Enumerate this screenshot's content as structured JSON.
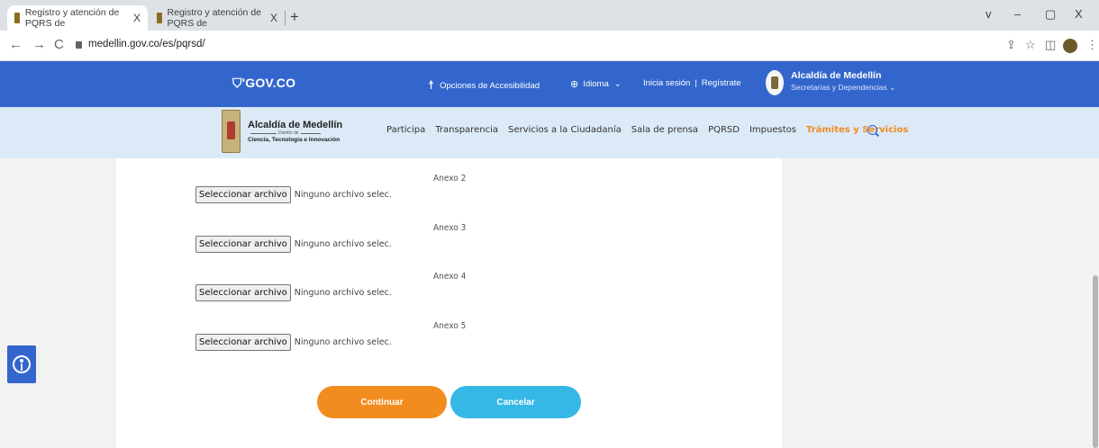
{
  "browser": {
    "tabs": [
      {
        "title": "Registro y atención de PQRS de",
        "close": "X"
      },
      {
        "title": "Registro y atención de PQRS de",
        "close": "X"
      }
    ],
    "new_tab": "+",
    "window_controls": [
      "v",
      "–",
      "▢",
      "X"
    ],
    "nav": {
      "back": "←",
      "forward": "→",
      "reload": "C"
    },
    "url": "medellin.gov.co/es/pqrsd/",
    "toolbar_icons": [
      "share-icon",
      "star-icon",
      "sidepanel-icon",
      "profile-avatar",
      "menu-icon"
    ],
    "toolbar_glyphs": {
      "share": "⇪",
      "star": "☆",
      "sidepanel": "◫",
      "menu": "⋮"
    }
  },
  "govbar": {
    "logo": "GOV.CO",
    "accessibility": "Opciones de Accesibilidad",
    "language": "Idioma",
    "login": "Inicia sesión",
    "separator": "|",
    "register": "Regístrate",
    "alcaldia_title": "Alcaldía de Medellín",
    "alcaldia_sub": "Secretarías y Dependencias"
  },
  "sitenav": {
    "brand_title": "Alcaldía de Medellín",
    "brand_district": "Distrito de",
    "brand_sub": "Ciencia, Tecnología e Innovación",
    "menu": [
      "Participa",
      "Transparencia",
      "Servicios a la Ciudadanía",
      "Sala de prensa",
      "PQRSD",
      "Impuestos",
      "Trámites y Servicios"
    ],
    "active_index": 6
  },
  "form": {
    "annexes": [
      {
        "label": "Anexo 2",
        "button": "Seleccionar archivo",
        "status": "Ninguno archivo selec."
      },
      {
        "label": "Anexo 3",
        "button": "Seleccionar archivo",
        "status": "Ninguno archivo selec."
      },
      {
        "label": "Anexo 4",
        "button": "Seleccionar archivo",
        "status": "Ninguno archivo selec."
      },
      {
        "label": "Anexo 5",
        "button": "Seleccionar archivo",
        "status": "Ninguno archivo selec."
      }
    ],
    "continue_label": "Continuar",
    "cancel_label": "Cancelar"
  },
  "colors": {
    "gov_blue": "#3366cc",
    "nav_bg": "#dce9f7",
    "accent_orange": "#f28c1f",
    "cancel_blue": "#35b8e6"
  }
}
